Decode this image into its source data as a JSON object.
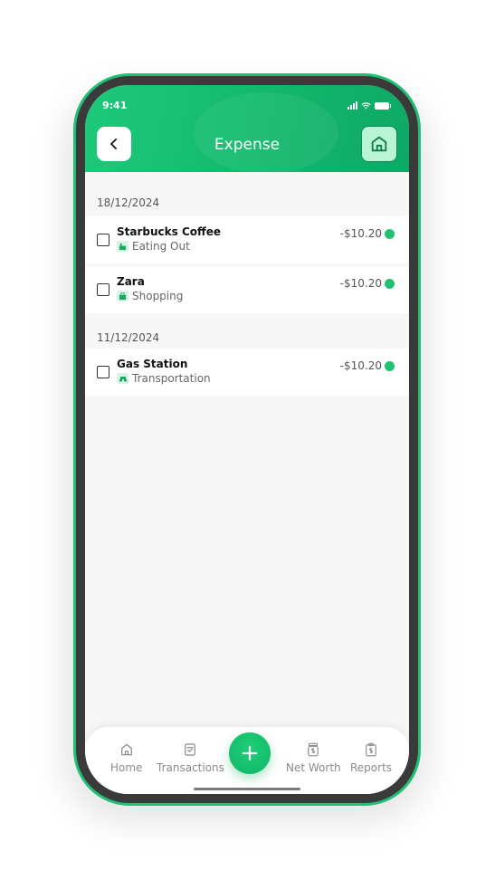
{
  "status": {
    "time": "9:41"
  },
  "header": {
    "title": "Expense"
  },
  "groups": [
    {
      "date": "18/12/2024",
      "items": [
        {
          "name": "Starbucks Coffee",
          "category": "Eating Out",
          "amount": "-$10.20",
          "status_color": "#1ec26f"
        },
        {
          "name": "Zara",
          "category": "Shopping",
          "amount": "-$10.20",
          "status_color": "#1ec26f"
        }
      ]
    },
    {
      "date": "11/12/2024",
      "items": [
        {
          "name": "Gas Station",
          "category": "Transportation",
          "amount": "-$10.20",
          "status_color": "#1ec26f"
        }
      ]
    }
  ],
  "tabbar": {
    "items": [
      {
        "label": "Home",
        "icon": "home-icon"
      },
      {
        "label": "Transactions",
        "icon": "transactions-icon"
      },
      {
        "label": "Net Worth",
        "icon": "net-worth-icon"
      },
      {
        "label": "Reports",
        "icon": "reports-icon"
      }
    ],
    "fab_icon": "plus-icon"
  },
  "colors": {
    "accent": "#12b86c",
    "accent_light": "#b9f4d7"
  }
}
